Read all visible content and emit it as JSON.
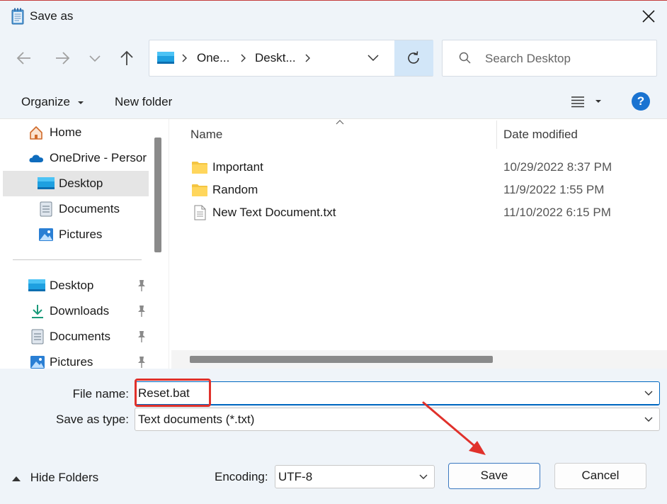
{
  "window": {
    "title": "Save as"
  },
  "address": {
    "segments": [
      "One...",
      "Deskt..."
    ]
  },
  "search": {
    "placeholder": "Search Desktop"
  },
  "toolbar": {
    "organize_label": "Organize",
    "new_folder_label": "New folder",
    "help_label": "?"
  },
  "sidebar": {
    "items": [
      {
        "label": "Home",
        "icon": "home-icon"
      },
      {
        "label": "OneDrive - Persor",
        "icon": "onedrive-icon"
      },
      {
        "label": "Desktop",
        "icon": "desktop-icon",
        "selected": true
      },
      {
        "label": "Documents",
        "icon": "documents-icon"
      },
      {
        "label": "Pictures",
        "icon": "pictures-icon"
      },
      {
        "label": "Desktop",
        "icon": "desktop-icon",
        "pinned": true
      },
      {
        "label": "Downloads",
        "icon": "download-icon",
        "pinned": true
      },
      {
        "label": "Documents",
        "icon": "documents-icon",
        "pinned": true
      },
      {
        "label": "Pictures",
        "icon": "pictures-icon",
        "pinned": true
      }
    ]
  },
  "filelist": {
    "columns": {
      "name": "Name",
      "date": "Date modified"
    },
    "rows": [
      {
        "name": "Important",
        "date": "10/29/2022 8:37 PM",
        "icon": "folder-icon"
      },
      {
        "name": "Random",
        "date": "11/9/2022 1:55 PM",
        "icon": "folder-icon"
      },
      {
        "name": "New Text Document.txt",
        "date": "11/10/2022 6:15 PM",
        "icon": "text-file-icon"
      }
    ]
  },
  "form": {
    "filename_label": "File name:",
    "filename_value": "Reset.bat",
    "savetype_label": "Save as type:",
    "savetype_value": "Text documents (*.txt)"
  },
  "footer": {
    "hide_folders_label": "Hide Folders",
    "encoding_label": "Encoding:",
    "encoding_value": "UTF-8",
    "save_label": "Save",
    "cancel_label": "Cancel"
  },
  "colors": {
    "accent": "#0067c0",
    "highlight_box": "#e0312b",
    "arrow": "#e0312b",
    "chrome_bg": "#eff4f9"
  }
}
